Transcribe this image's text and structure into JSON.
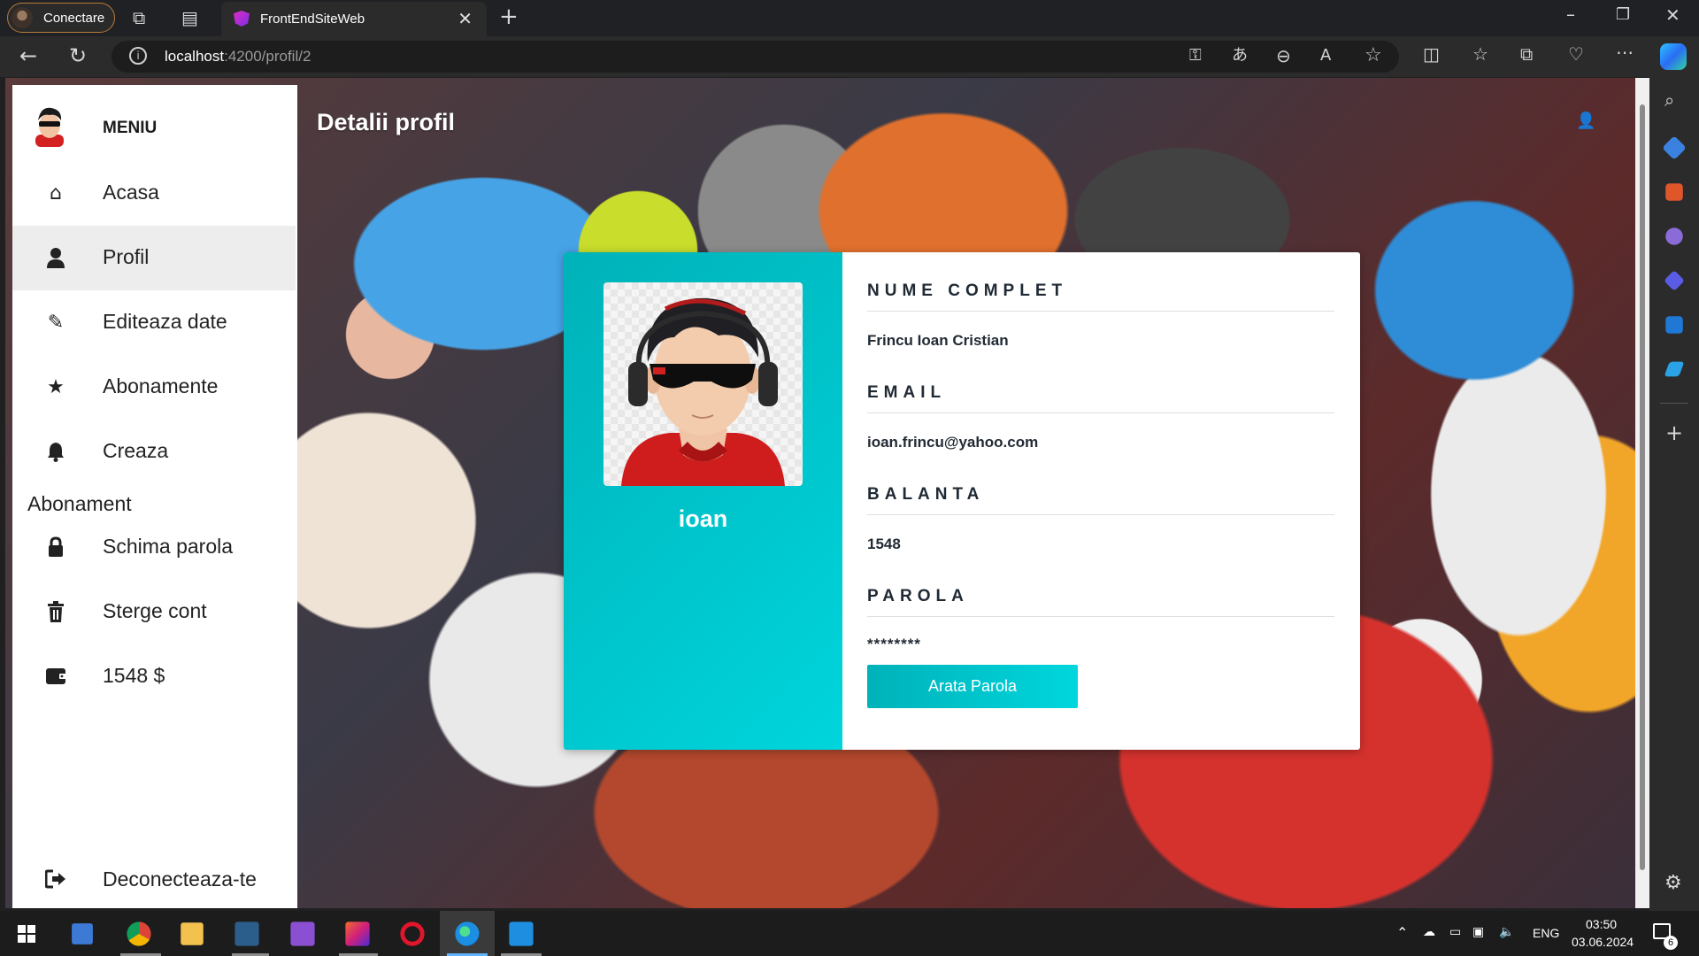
{
  "browser": {
    "profile_label": "Conectare",
    "tab_title": "FrontEndSiteWeb",
    "url_host": "localhost",
    "url_path": ":4200/profil/2"
  },
  "sidebar": {
    "title": "MENIU",
    "items": [
      {
        "label": "Acasa",
        "icon": "home-icon"
      },
      {
        "label": "Profil",
        "icon": "user-icon",
        "active": true
      },
      {
        "label": "Editeaza date",
        "icon": "pencil-icon"
      },
      {
        "label": "Abonamente",
        "icon": "star-icon"
      },
      {
        "label": "Creaza",
        "icon": "bell-icon"
      },
      {
        "label": "Schima parola",
        "icon": "lock-icon"
      },
      {
        "label": "Sterge cont",
        "icon": "trash-icon"
      },
      {
        "label": "1548 $",
        "icon": "wallet-icon"
      },
      {
        "label": "Deconecteaza-te",
        "icon": "logout-icon"
      }
    ],
    "wrap_text": "Abonament"
  },
  "page": {
    "title": "Detalii profil"
  },
  "profile": {
    "username": "ioan",
    "fields": [
      {
        "label": "NUME COMPLET",
        "value": "Frincu Ioan Cristian"
      },
      {
        "label": "EMAIL",
        "value": "ioan.frincu@yahoo.com"
      },
      {
        "label": "BALANTA",
        "value": "1548"
      },
      {
        "label": "PAROLA",
        "value": "********"
      }
    ],
    "show_password_button": "Arata Parola"
  },
  "taskbar": {
    "language": "ENG",
    "time": "03:50",
    "date": "03.06.2024",
    "notifications": "6"
  },
  "colors": {
    "accent_teal": "#00c4cc",
    "sidebar_bg": "#ffffff",
    "active_item_bg": "#ededed"
  }
}
